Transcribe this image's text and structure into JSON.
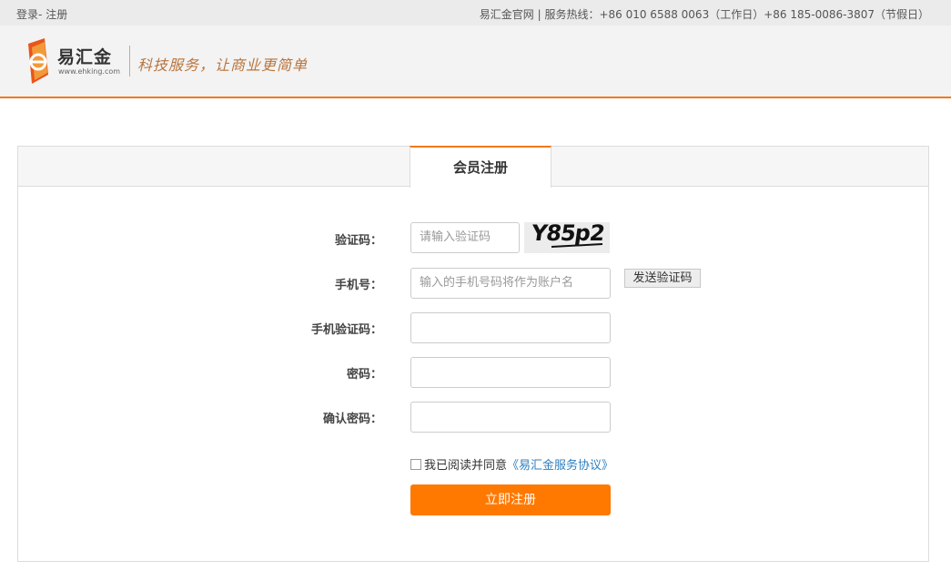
{
  "topbar": {
    "login": "登录",
    "separator": "-",
    "register": "注册",
    "contact": "易汇金官网 | 服务热线：+86 010 6588 0063（工作日）+86 185-0086-3807（节假日）"
  },
  "header": {
    "logo_name": "易汇金",
    "logo_url": "www.ehking.com",
    "slogan": "科技服务，让商业更简单",
    "accent_color": "#f07a1a"
  },
  "tabs": {
    "active": "会员注册"
  },
  "form": {
    "captcha": {
      "label": "验证码：",
      "placeholder": "请输入验证码",
      "image_text": "Y85p2"
    },
    "phone": {
      "label": "手机号：",
      "placeholder": "输入的手机号码将作为账户名",
      "send_code": "发送验证码"
    },
    "sms_code": {
      "label": "手机验证码：",
      "value": ""
    },
    "password": {
      "label": "密码：",
      "value": ""
    },
    "confirm_password": {
      "label": "确认密码：",
      "value": ""
    },
    "agreement": {
      "text": "我已阅读并同意",
      "link": "《易汇金服务协议》",
      "checked": false
    },
    "submit": "立即注册"
  },
  "colors": {
    "submit_bg": "#ff7800",
    "link": "#2d7fc1"
  }
}
